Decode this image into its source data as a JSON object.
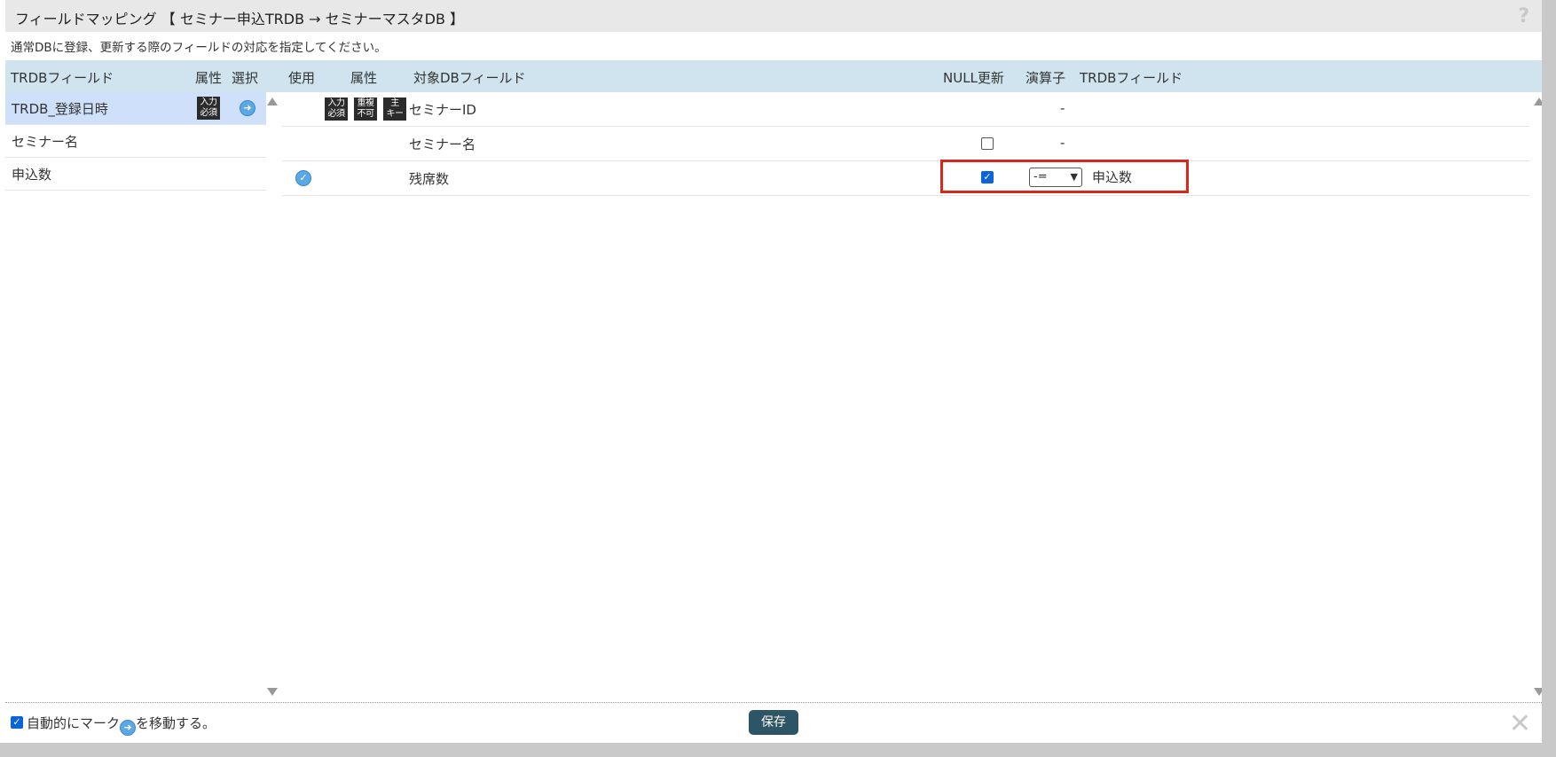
{
  "dialog": {
    "title": "フィールドマッピング 【 セミナー申込TRDB → セミナーマスタDB 】",
    "help_icon": "?",
    "description": "通常DBに登録、更新する際のフィールドの対応を指定してください。"
  },
  "header": {
    "trdb_field": "TRDBフィールド",
    "attr_left": "属性",
    "select": "選択",
    "use": "使用",
    "attr_right": "属性",
    "target_db_field": "対象DBフィールド",
    "null_update": "NULL更新",
    "operator": "演算子",
    "trdb_field_right": "TRDBフィールド"
  },
  "left_fields": [
    {
      "label": "TRDB_登録日時",
      "badge": "入力必須",
      "badge_l1": "入力",
      "badge_l2": "必須",
      "selected": true
    },
    {
      "label": "セミナー名"
    },
    {
      "label": "申込数"
    }
  ],
  "right_fields": [
    {
      "name": "セミナーID",
      "badges": [
        {
          "l1": "入力",
          "l2": "必須"
        },
        {
          "l1": "重複",
          "l2": "不可"
        },
        {
          "l1": "主",
          "l2": "キー"
        }
      ],
      "operator_text": "-"
    },
    {
      "name": "セミナー名",
      "null_update": false,
      "operator_text": "-"
    },
    {
      "name": "残席数",
      "used": true,
      "null_update": true,
      "operator": "-=",
      "trdb_field": "申込数"
    }
  ],
  "footer": {
    "auto_move_text": "自動的にマーク➡を移動する。",
    "auto_move_prefix": "自動的にマーク",
    "auto_move_suffix": "を移動する。",
    "auto_move_checked": true,
    "save_label": "保存",
    "close_icon": "✕"
  },
  "colors": {
    "header_bg": "#cfe4ee",
    "selected_row_bg": "#cfe0fb",
    "highlight_border": "#d8281c",
    "save_button_bg": "#2d5566",
    "checkbox_checked": "#0b65d8"
  },
  "icons": {
    "select_arrow": "arrow-circle-right-icon",
    "use_check": "check-circle-icon",
    "scroll_up": "triangle-up-icon",
    "scroll_down": "triangle-down-icon"
  }
}
